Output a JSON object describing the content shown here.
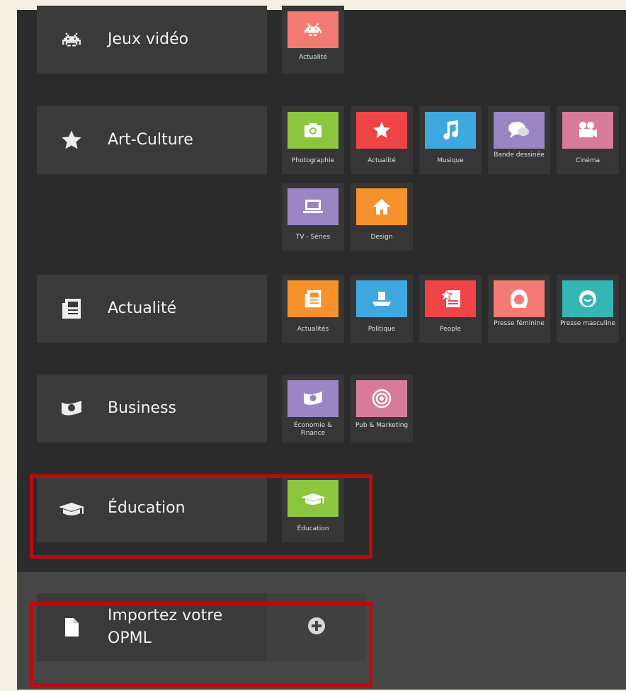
{
  "categories": [
    {
      "key": "jeux",
      "label": "Jeux vidéo",
      "icon": "space-invader-icon",
      "tiles": [
        {
          "label": "Actualité",
          "icon": "space-invader-icon",
          "color": "#f47b74"
        }
      ]
    },
    {
      "key": "art",
      "label": "Art-Culture",
      "icon": "star-icon",
      "tiles": [
        {
          "label": "Photographie",
          "icon": "camera-icon",
          "color": "#8cc63e"
        },
        {
          "label": "Actualité",
          "icon": "star-icon",
          "color": "#ef4446"
        },
        {
          "label": "Musique",
          "icon": "music-note-icon",
          "color": "#3fa8de"
        },
        {
          "label": "Bande dessinée",
          "icon": "speech-bubble-icon",
          "color": "#9a86c4"
        },
        {
          "label": "Cinéma",
          "icon": "film-camera-icon",
          "color": "#d77b98"
        },
        {
          "label": "TV - Séries",
          "icon": "laptop-icon",
          "color": "#9a86c4"
        },
        {
          "label": "Design",
          "icon": "house-icon",
          "color": "#f5922c"
        }
      ]
    },
    {
      "key": "actu",
      "label": "Actualité",
      "icon": "newspaper-icon",
      "tiles": [
        {
          "label": "Actualités",
          "icon": "newspaper-icon",
          "color": "#f5922c"
        },
        {
          "label": "Politique",
          "icon": "podium-icon",
          "color": "#3fa8de"
        },
        {
          "label": "People",
          "icon": "star-news-icon",
          "color": "#ef4446"
        },
        {
          "label": "Presse féminine",
          "icon": "woman-face-icon",
          "color": "#f47b74"
        },
        {
          "label": "Presse masculine",
          "icon": "man-face-icon",
          "color": "#33b6b4"
        }
      ]
    },
    {
      "key": "business",
      "label": "Business",
      "icon": "money-icon",
      "tiles": [
        {
          "label": "Économie & Finance",
          "icon": "money-icon",
          "color": "#9a86c4"
        },
        {
          "label": "Pub & Marketing",
          "icon": "target-icon",
          "color": "#d77b98"
        }
      ]
    },
    {
      "key": "education",
      "label": "Éducation",
      "icon": "graduation-cap-icon",
      "tiles": [
        {
          "label": "Éducation",
          "icon": "graduation-cap-icon",
          "color": "#8cc63e"
        }
      ]
    }
  ],
  "import": {
    "label_line1": "Importez votre",
    "label_line2": "OPML",
    "icon": "document-icon",
    "add_icon": "plus-circle-icon"
  },
  "colors": {
    "highlight": "#c0080c",
    "panel": "#2b2b2b",
    "tile": "#363636"
  }
}
